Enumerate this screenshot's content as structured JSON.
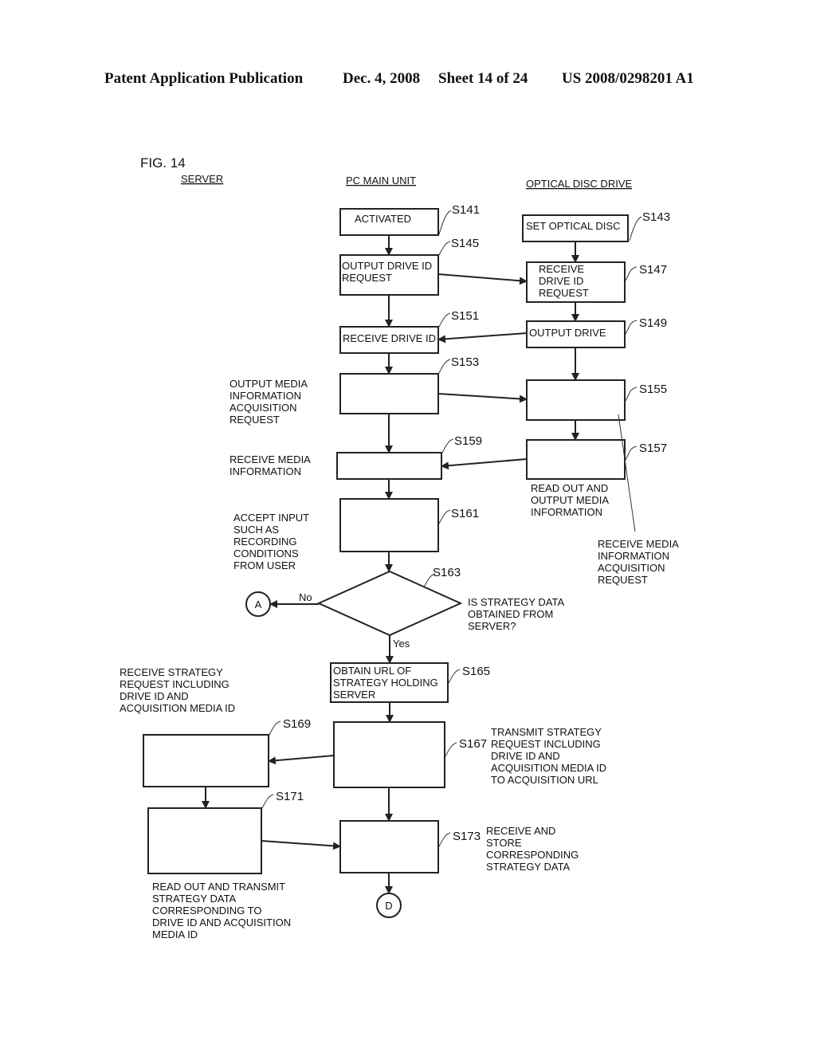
{
  "header": {
    "publication": "Patent Application Publication",
    "date": "Dec. 4, 2008",
    "sheet": "Sheet 14 of 24",
    "number": "US 2008/0298201 A1"
  },
  "figure": {
    "label": "FIG. 14",
    "lanes": [
      "SERVER",
      "PC MAIN UNIT",
      "OPTICAL DISC DRIVE"
    ]
  },
  "steps": {
    "s141": {
      "id": "S141",
      "lines": [
        "ACTIVATED"
      ]
    },
    "s143": {
      "id": "S143",
      "lines": [
        "SET OPTICAL DISC"
      ]
    },
    "s145": {
      "id": "S145",
      "lines": [
        "OUTPUT DRIVE ID",
        "REQUEST"
      ]
    },
    "s147": {
      "id": "S147",
      "lines": [
        "RECEIVE",
        "DRIVE ID",
        "REQUEST"
      ]
    },
    "s149": {
      "id": "S149",
      "lines": [
        "OUTPUT DRIVE"
      ]
    },
    "s151": {
      "id": "S151",
      "lines": [
        "RECEIVE DRIVE ID"
      ]
    },
    "s153": {
      "id": "S153",
      "lines": [
        "OUTPUT MEDIA",
        "INFORMATION",
        "ACQUISITION",
        "REQUEST"
      ]
    },
    "s155": {
      "id": "S155",
      "lines": [
        "RECEIVE MEDIA",
        "INFORMATION",
        "ACQUISITION",
        "REQUEST"
      ]
    },
    "s157": {
      "id": "S157",
      "lines": [
        "READ OUT AND",
        "OUTPUT MEDIA",
        "INFORMATION"
      ]
    },
    "s159": {
      "id": "S159",
      "lines": [
        "RECEIVE MEDIA",
        "INFORMATION"
      ]
    },
    "s161": {
      "id": "S161",
      "lines": [
        "ACCEPT INPUT",
        "SUCH AS",
        "RECORDING",
        "CONDITIONS",
        "FROM USER"
      ]
    },
    "s163": {
      "id": "S163",
      "lines": [
        "IS STRATEGY DATA",
        "OBTAINED FROM",
        "SERVER?"
      ],
      "no": "No",
      "yes": "Yes"
    },
    "s165": {
      "id": "S165",
      "lines": [
        "OBTAIN URL OF",
        "STRATEGY HOLDING",
        "SERVER"
      ]
    },
    "s167": {
      "id": "S167",
      "lines": [
        "TRANSMIT STRATEGY",
        "REQUEST INCLUDING",
        "DRIVE ID AND",
        "ACQUISITION MEDIA ID",
        "TO ACQUISITION URL"
      ]
    },
    "s169": {
      "id": "S169",
      "lines": [
        "RECEIVE STRATEGY",
        "REQUEST INCLUDING",
        "DRIVE ID AND",
        "ACQUISITION MEDIA ID"
      ]
    },
    "s171": {
      "id": "S171",
      "lines": [
        "READ OUT AND TRANSMIT",
        "STRATEGY DATA",
        "CORRESPONDING TO",
        "DRIVE ID AND ACQUISITION",
        "MEDIA ID"
      ]
    },
    "s173": {
      "id": "S173",
      "lines": [
        "RECEIVE AND",
        "STORE",
        "CORRESPONDING",
        "STRATEGY DATA"
      ]
    }
  },
  "connectors": {
    "a": "A",
    "d": "D"
  }
}
